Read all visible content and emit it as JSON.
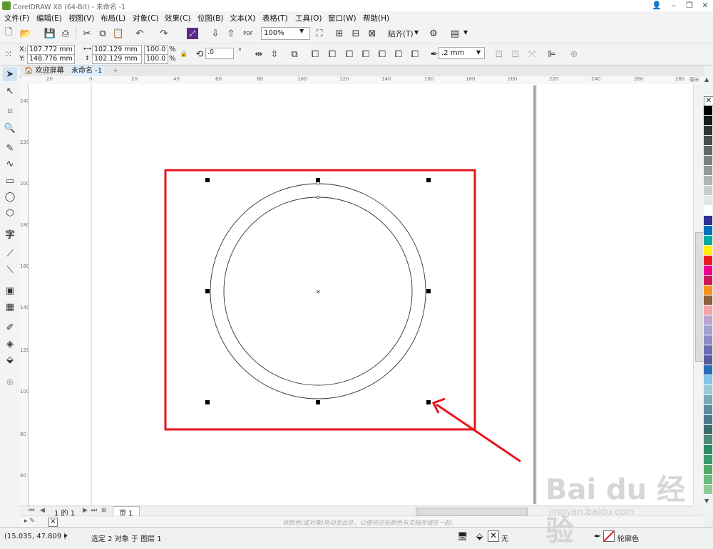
{
  "window": {
    "title": "CorelDRAW X8 (64-Bit) - 未命名 -1"
  },
  "menu": [
    "文件(F)",
    "编辑(E)",
    "视图(V)",
    "布局(L)",
    "对象(C)",
    "效果(C)",
    "位图(B)",
    "文本(X)",
    "表格(T)",
    "工具(O)",
    "窗口(W)",
    "帮助(H)"
  ],
  "toolbar": {
    "zoom": "100%",
    "snap_label": "贴齐(T)",
    "pdf_label": "PDF"
  },
  "property_bar": {
    "x_label": "X:",
    "x_value": "107.772 mm",
    "y_label": "Y:",
    "y_value": "148.776 mm",
    "w_value": "102.129 mm",
    "h_value": "102.129 mm",
    "scale_w": "100.0",
    "scale_h": "100.0",
    "pct": "%",
    "rotation": ".0",
    "degree": "°",
    "outline_width": ".2 mm"
  },
  "tabs": {
    "welcome": "欢迎屏幕",
    "doc": "未命名 -1",
    "add": "+"
  },
  "ruler": {
    "h_labels": [
      "20",
      "0",
      "20",
      "40",
      "60",
      "80",
      "100",
      "120",
      "140",
      "160",
      "180",
      "200",
      "220",
      "240",
      "260",
      "280"
    ],
    "h_unit": "毫米",
    "v_labels": [
      "240",
      "220",
      "200",
      "180",
      "160",
      "140",
      "120",
      "100",
      "80",
      "60"
    ]
  },
  "page_nav": {
    "page_counter": "1 的 1",
    "page_tab": "页 1"
  },
  "hint_text": "将颜色(或对象)拖动至此处，以便将这些颜色与文档存储在一起。",
  "status": {
    "coords": "(15.035, 47.809 )",
    "arrow": "▸",
    "selection": "选定 2 对象 于 图层 1",
    "fill_none": "无",
    "outline_label": "轮廓色"
  },
  "colors": {
    "highlight_box": "#e8141b",
    "palette": [
      "#000000",
      "#1a1a1a",
      "#333333",
      "#4d4d4d",
      "#666666",
      "#808080",
      "#999999",
      "#b3b3b3",
      "#cccccc",
      "#e6e6e6",
      "#ffffff",
      "#2e3192",
      "#0071bc",
      "#00a99d",
      "#fff200",
      "#ed1c24",
      "#ec008c",
      "#d4145a",
      "#f7941d",
      "#8b5e3c",
      "#f5a3a8",
      "#bda4cf",
      "#a3a1d1",
      "#8e8cc4",
      "#6c6cb0",
      "#5a5a9e",
      "#2a6fb5",
      "#84c3e6",
      "#9cc7d9",
      "#7fa6b9",
      "#5f8aa0",
      "#4d7a8c",
      "#3f6d6b",
      "#4f8a7a",
      "#2f8a6a",
      "#3a9a6e",
      "#56a86a",
      "#6fba7d",
      "#8fcc93"
    ]
  },
  "watermark": {
    "logo": "Bai du 经验",
    "url": "jingyan.baidu.com"
  }
}
